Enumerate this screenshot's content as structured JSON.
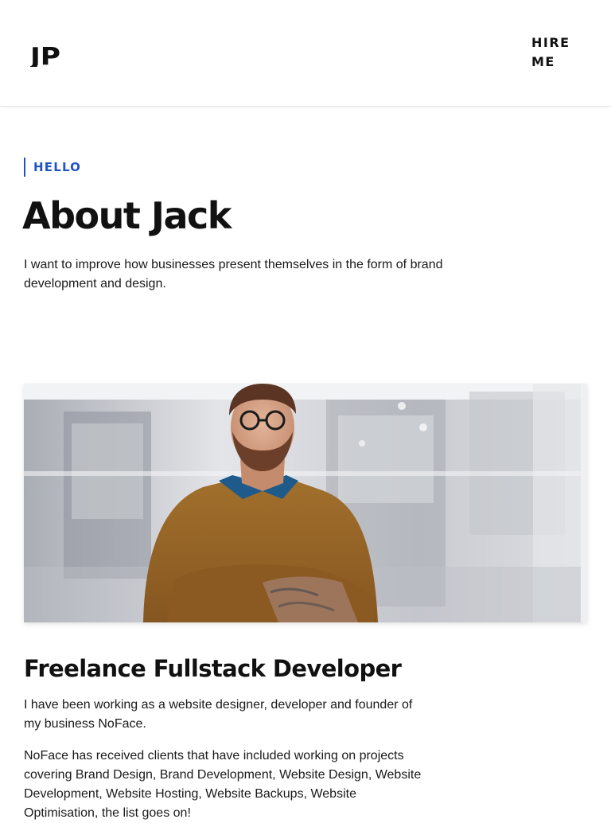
{
  "header": {
    "logo_text": "JP",
    "hire_me_label": "HIRE ME"
  },
  "intro": {
    "eyebrow": "HELLO",
    "title": "About Jack",
    "text": "I want to improve how businesses present themselves in the form of brand development and design."
  },
  "section": {
    "title": "Freelance Fullstack Developer",
    "paragraph_1": "I have been working as a website designer, developer and founder of my business NoFace.",
    "paragraph_2": "NoFace has received clients that have included working on projects covering Brand Design, Brand Development, Website Design, Website Development, Website Hosting, Website Backups, Website Optimisation, the list goes on!"
  },
  "colors": {
    "accent": "#1f54c4",
    "text": "#111111",
    "background": "#ffffff"
  },
  "icons": {
    "logo": "jp-logo-icon",
    "photo": "portrait-photo"
  }
}
